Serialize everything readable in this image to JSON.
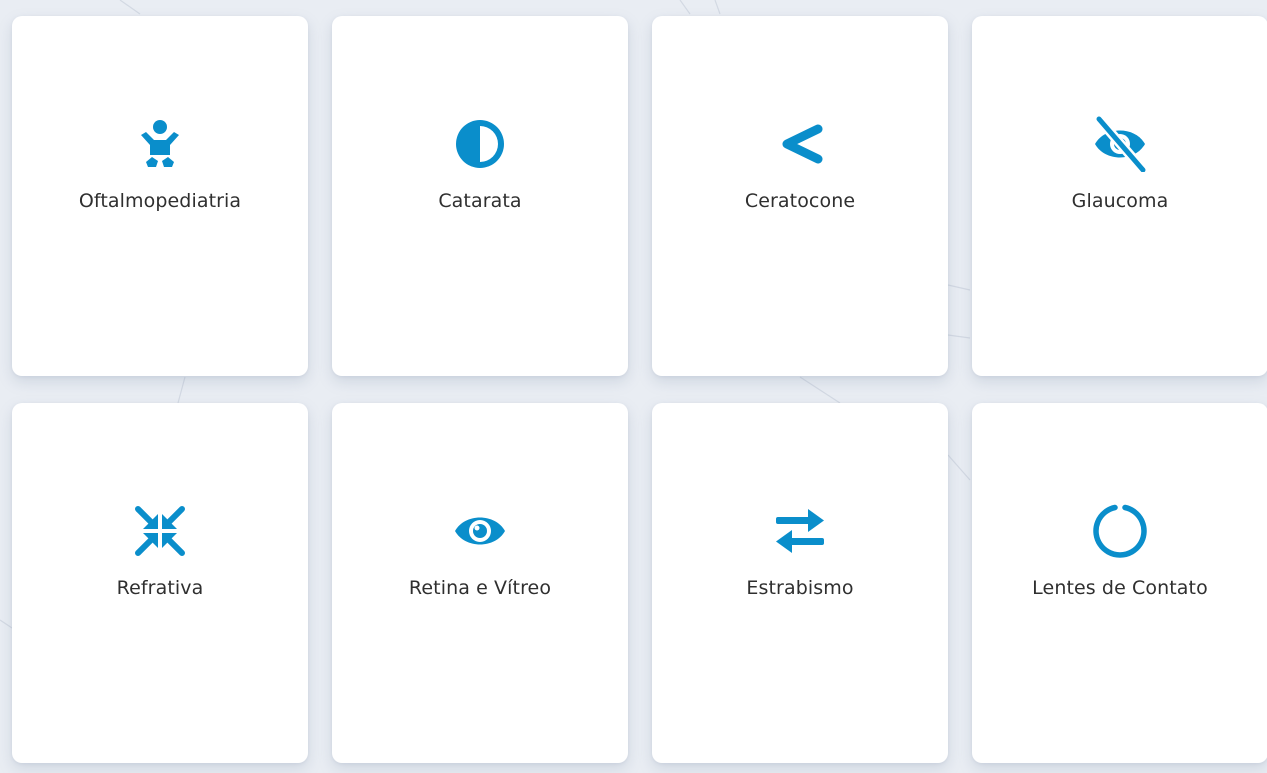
{
  "theme": {
    "accent": "#0a8ecb",
    "card_bg": "#ffffff",
    "page_bg": "#e9edf3",
    "text": "#2f2f2f"
  },
  "cards": [
    {
      "label": "Oftalmopediatria",
      "icon": "baby-icon"
    },
    {
      "label": "Catarata",
      "icon": "half-circle-contrast-icon"
    },
    {
      "label": "Ceratocone",
      "icon": "chevron-left-icon"
    },
    {
      "label": "Glaucoma",
      "icon": "eye-slash-icon"
    },
    {
      "label": "Refrativa",
      "icon": "compress-arrows-icon"
    },
    {
      "label": "Retina e Vítreo",
      "icon": "eye-icon"
    },
    {
      "label": "Estrabismo",
      "icon": "exchange-arrows-icon"
    },
    {
      "label": "Lentes de Contato",
      "icon": "circle-notch-icon"
    }
  ]
}
